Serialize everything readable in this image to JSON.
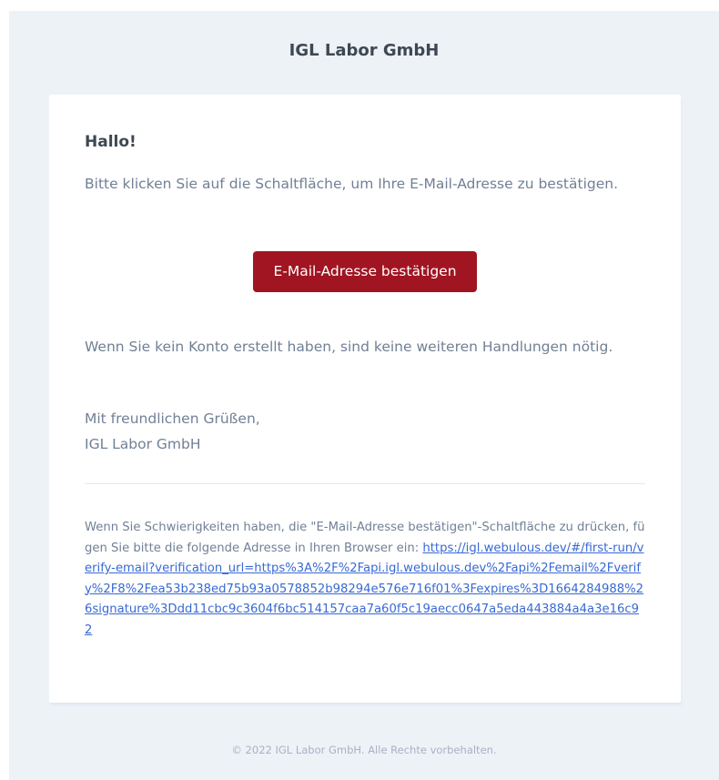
{
  "header": {
    "title": "IGL Labor GmbH"
  },
  "card": {
    "greeting": "Hallo!",
    "intro": "Bitte klicken Sie auf die Schaltfläche, um Ihre E-Mail-Adresse zu bestätigen.",
    "button_label": "E-Mail-Adresse bestätigen",
    "no_action": "Wenn Sie kein Konto erstellt haben, sind keine weiteren Handlungen nötig.",
    "salutation": "Mit freundlichen Grüßen,",
    "signature": "IGL Labor GmbH",
    "subcopy_text": "Wenn Sie Schwierigkeiten haben, die \"E-Mail-Adresse bestätigen\"-Schaltfläche zu drücken, fügen Sie bitte die folgende Adresse in Ihren Browser ein: ",
    "subcopy_link": "https://igl.webulous.dev/#/first-run/verify-email?verification_url=https%3A%2F%2Fapi.igl.webulous.dev%2Fapi%2Femail%2Fverify%2F8%2Fea53b238ed75b93a0578852b98294e576e716f01%3Fexpires%3D1664284988%26signature%3Ddd11cbc9c3604f6bc514157caa7a60f5c19aecc0647a5eda443884a4a3e16c92"
  },
  "footer": {
    "copyright": "© 2022 IGL Labor GmbH. Alle Rechte vorbehalten."
  },
  "colors": {
    "background": "#edf2f7",
    "card": "#ffffff",
    "button": "#a01521",
    "link": "#3869d4",
    "text": "#718096",
    "heading": "#3d4852"
  }
}
